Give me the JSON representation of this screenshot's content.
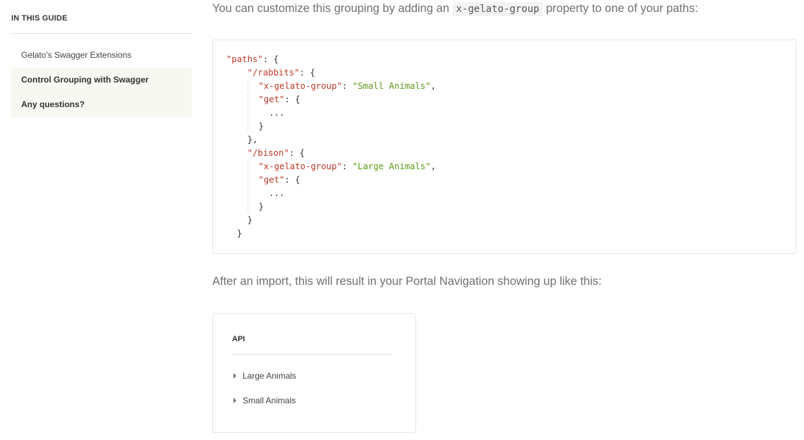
{
  "sidebar": {
    "heading": "IN THIS GUIDE",
    "items": [
      {
        "label": "Gelato's Swagger Extensions"
      },
      {
        "label": "Control Grouping with Swagger"
      },
      {
        "label": "Any questions?"
      }
    ]
  },
  "main": {
    "intro_before": "You can customize this grouping by adding an ",
    "intro_code": "x-gelato-group",
    "intro_after": " property to one of your paths:",
    "code": {
      "k_paths": "\"paths\"",
      "k_rabbits": "\"/rabbits\"",
      "k_group": "\"x-gelato-group\"",
      "v_small": "\"Small Animals\"",
      "k_get": "\"get\"",
      "ellipsis": "...",
      "k_bison": "\"/bison\"",
      "v_large": "\"Large Animals\""
    },
    "after_text": "After an import, this will result in your Portal Navigation showing up like this:",
    "nav_preview": {
      "heading": "API",
      "items": [
        {
          "label": "Large Animals"
        },
        {
          "label": "Small Animals"
        }
      ]
    }
  }
}
